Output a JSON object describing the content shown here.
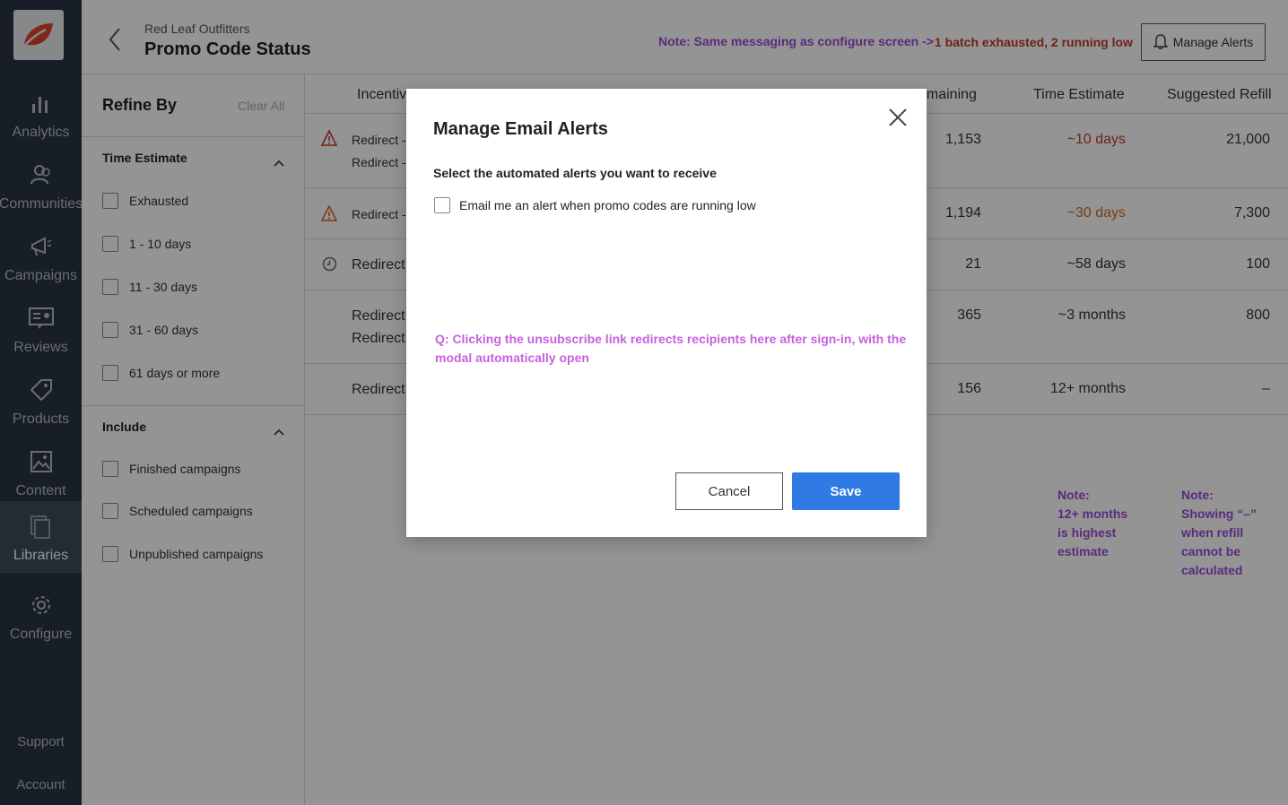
{
  "nav": {
    "items": [
      {
        "label": "Analytics",
        "icon": "bar-chart-icon"
      },
      {
        "label": "Communities",
        "icon": "people-icon"
      },
      {
        "label": "Campaigns",
        "icon": "megaphone-icon"
      },
      {
        "label": "Reviews",
        "icon": "review-card-icon"
      },
      {
        "label": "Products",
        "icon": "tag-icon"
      },
      {
        "label": "Content",
        "icon": "image-icon"
      },
      {
        "label": "Libraries",
        "icon": "library-icon"
      },
      {
        "label": "Configure",
        "icon": "gear-icon"
      }
    ],
    "active": "Libraries",
    "support": "Support",
    "account": "Account"
  },
  "header": {
    "org": "Red Leaf Outfitters",
    "title": "Promo Code Status",
    "note": "Note: Same messaging as configure screen ->",
    "status": "1 batch exhausted, 2 running low",
    "manage_alerts": "Manage Alerts"
  },
  "filters": {
    "title": "Refine By",
    "clear_all": "Clear All",
    "time_estimate": {
      "title": "Time Estimate",
      "options": [
        "Exhausted",
        "1 - 10 days",
        "11 - 30 days",
        "31 - 60 days",
        "61 days or more"
      ]
    },
    "include": {
      "title": "Include",
      "options": [
        "Finished campaigns",
        "Scheduled campaigns",
        "Unpublished campaigns"
      ]
    }
  },
  "table": {
    "headers": {
      "incentive": "Incentiv",
      "remaining": "emaining",
      "time_estimate": "Time Estimate",
      "suggested_refill": "Suggested Refill"
    },
    "rows": [
      {
        "line1": "Redirect -",
        "line2": "Redirect -",
        "remaining": "1,153",
        "time": "~10 days",
        "refill": "21,000",
        "icon": "warning-icon"
      },
      {
        "line1": "Redirect -",
        "line2": "",
        "remaining": "1,194",
        "time": "~30 days",
        "refill": "7,300",
        "icon": "warning-icon"
      },
      {
        "line1": "Redirect",
        "line2": "",
        "remaining": "21",
        "time": "~58 days",
        "refill": "100",
        "icon": "clock-icon"
      },
      {
        "line1": "Redirect",
        "line2": "Redirect",
        "remaining": "365",
        "time": "~3 months",
        "refill": "800",
        "icon": ""
      },
      {
        "line1": "Redirect",
        "line2": "",
        "remaining": "156",
        "time": "12+ months",
        "refill": "–",
        "icon": ""
      }
    ],
    "note1": [
      "Note:",
      "12+ months",
      "is highest",
      "estimate"
    ],
    "note2": [
      "Note:",
      "Showing “–”",
      "when refill",
      "cannot be",
      "calculated"
    ]
  },
  "modal": {
    "title": "Manage Email Alerts",
    "subtitle": "Select the automated alerts you want to receive",
    "option": "Email me an alert when promo codes are running low",
    "question": "Q: Clicking the unsubscribe link redirects recipients here after sign-in, with the modal automatically open",
    "cancel": "Cancel",
    "save": "Save"
  },
  "colors": {
    "rail": "#2a3544",
    "accent": "#2f7ae5",
    "alert_red": "#c0392b",
    "note_purple": "#9b4bd8"
  }
}
